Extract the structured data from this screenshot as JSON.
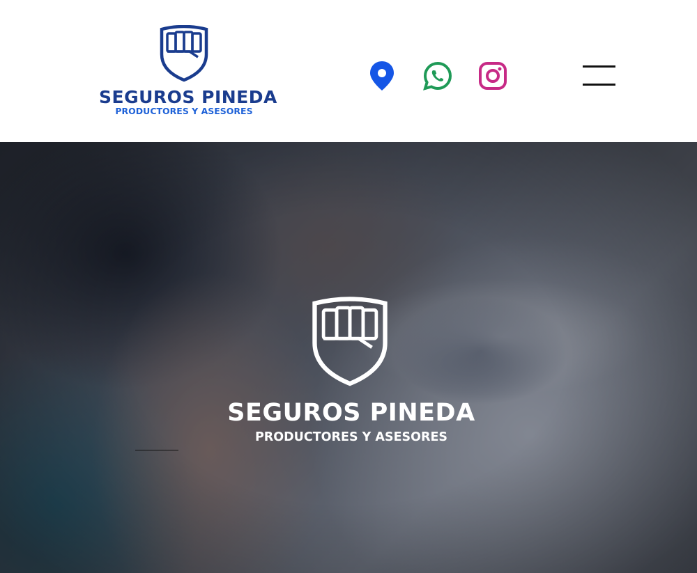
{
  "header": {
    "logo": {
      "brand": "SEGUROS PINEDA",
      "tagline": "PRODUCTORES Y ASESORES",
      "icon": "shield-fist-icon",
      "brand_color": "#1a3c8e",
      "tagline_color": "#1f62d8"
    },
    "social": [
      {
        "name": "location",
        "icon": "map-pin-icon",
        "color": "#1556e6"
      },
      {
        "name": "whatsapp",
        "icon": "whatsapp-icon",
        "color": "#1f9a57"
      },
      {
        "name": "instagram",
        "icon": "instagram-icon",
        "color": "#c72a86"
      }
    ],
    "menu_icon": "hamburger-menu-icon"
  },
  "hero": {
    "brand": "SEGUROS PINEDA",
    "tagline": "PRODUCTORES Y ASESORES",
    "icon": "shield-fist-icon",
    "text_color": "#ffffff"
  }
}
